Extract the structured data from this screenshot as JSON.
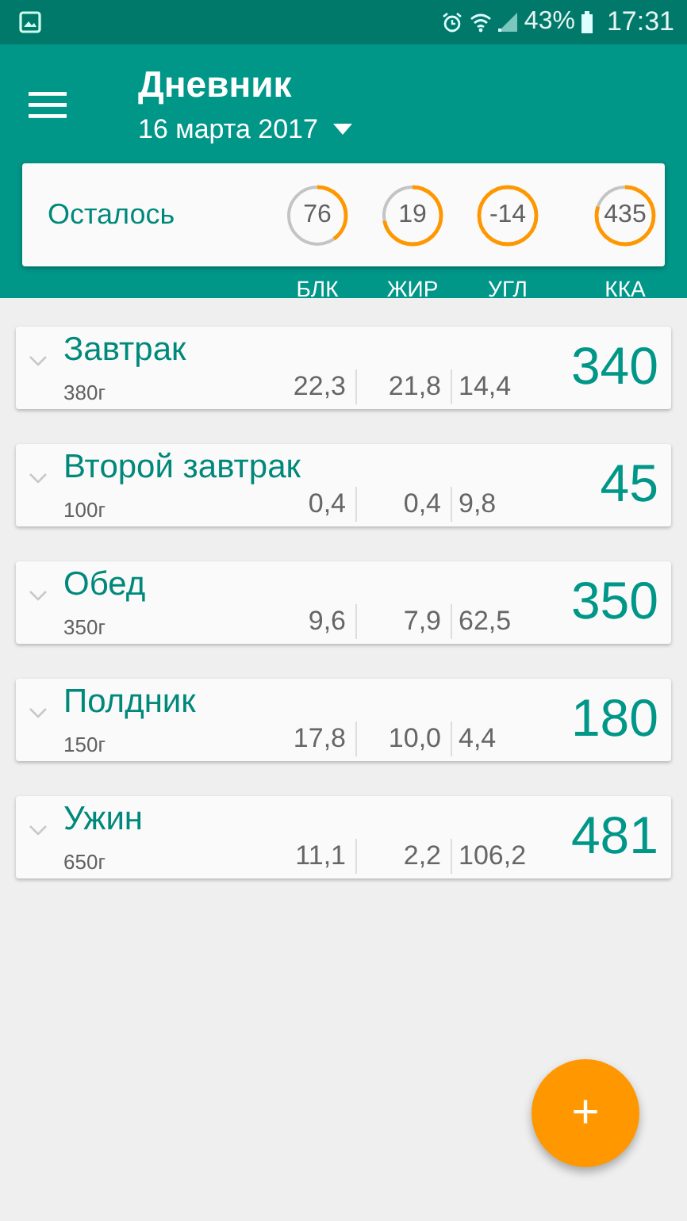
{
  "status_bar": {
    "battery": "43%",
    "time": "17:31"
  },
  "header": {
    "title": "Дневник",
    "date": "16 марта 2017"
  },
  "summary": {
    "label": "Осталось",
    "rings": [
      {
        "value": "76",
        "caption": "БЛК",
        "level": 0.4
      },
      {
        "value": "19",
        "caption": "ЖИР",
        "level": 0.72
      },
      {
        "value": "-14",
        "caption": "УГЛ",
        "level": 1
      },
      {
        "value": "435",
        "caption": "ККА",
        "level": 0.8
      }
    ]
  },
  "meals": [
    {
      "name": "Завтрак",
      "weight": "380г",
      "nutrients": [
        "22,3",
        "21,8",
        "14,4"
      ],
      "kcal": "340"
    },
    {
      "name": "Второй завтрак",
      "weight": "100г",
      "nutrients": [
        "0,4",
        "0,4",
        "9,8"
      ],
      "kcal": "45"
    },
    {
      "name": "Обед",
      "weight": "350г",
      "nutrients": [
        "9,6",
        "7,9",
        "62,5"
      ],
      "kcal": "350"
    },
    {
      "name": "Полдник",
      "weight": "150г",
      "nutrients": [
        "17,8",
        "10,0",
        "4,4"
      ],
      "kcal": "180"
    },
    {
      "name": "Ужин",
      "weight": "650г",
      "nutrients": [
        "11,1",
        "2,2",
        "106,2"
      ],
      "kcal": "481"
    }
  ],
  "fab": {
    "label": "+"
  }
}
